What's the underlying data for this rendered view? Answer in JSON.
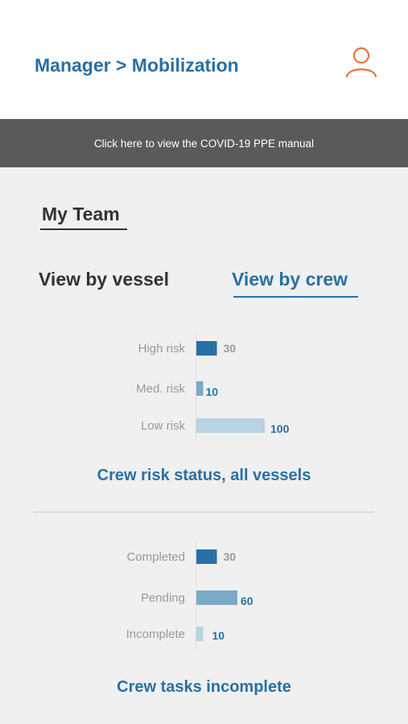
{
  "header": {
    "breadcrumb": "Manager > Mobilization",
    "user_icon": "user-icon",
    "user_icon_color": "#e8733a"
  },
  "banner": {
    "text": "Click here to view the COVID-19 PPE manual"
  },
  "section": {
    "title": "My Team"
  },
  "tabs": [
    {
      "label": "View by vessel",
      "active": false
    },
    {
      "label": "View by crew",
      "active": true
    }
  ],
  "colors": {
    "accent": "#2870a5",
    "text": "#333333"
  },
  "chart_data": [
    {
      "type": "bar",
      "orientation": "horizontal",
      "title": "Crew risk status, all vessels",
      "categories": [
        "High risk",
        "Med. risk",
        "Low risk"
      ],
      "values": [
        30,
        10,
        100
      ],
      "value_labels": [
        "30",
        "10",
        "100"
      ],
      "colors": [
        "#2870a5",
        "#7aaac6",
        "#b8d3e2"
      ],
      "label_colors": [
        "#999999",
        "#2870a5",
        "#2870a5"
      ],
      "xlim": [
        0,
        100
      ],
      "grid": false,
      "legend": "none"
    },
    {
      "type": "bar",
      "orientation": "horizontal",
      "title": "Crew tasks incomplete",
      "categories": [
        "Completed",
        "Pending",
        "Incomplete"
      ],
      "values": [
        30,
        60,
        10
      ],
      "value_labels": [
        "30",
        "60",
        "10"
      ],
      "colors": [
        "#2870a5",
        "#7aaac6",
        "#b8d3e2"
      ],
      "label_colors": [
        "#999999",
        "#2870a5",
        "#2870a5"
      ],
      "xlim": [
        0,
        100
      ],
      "grid": false,
      "legend": "none"
    }
  ]
}
